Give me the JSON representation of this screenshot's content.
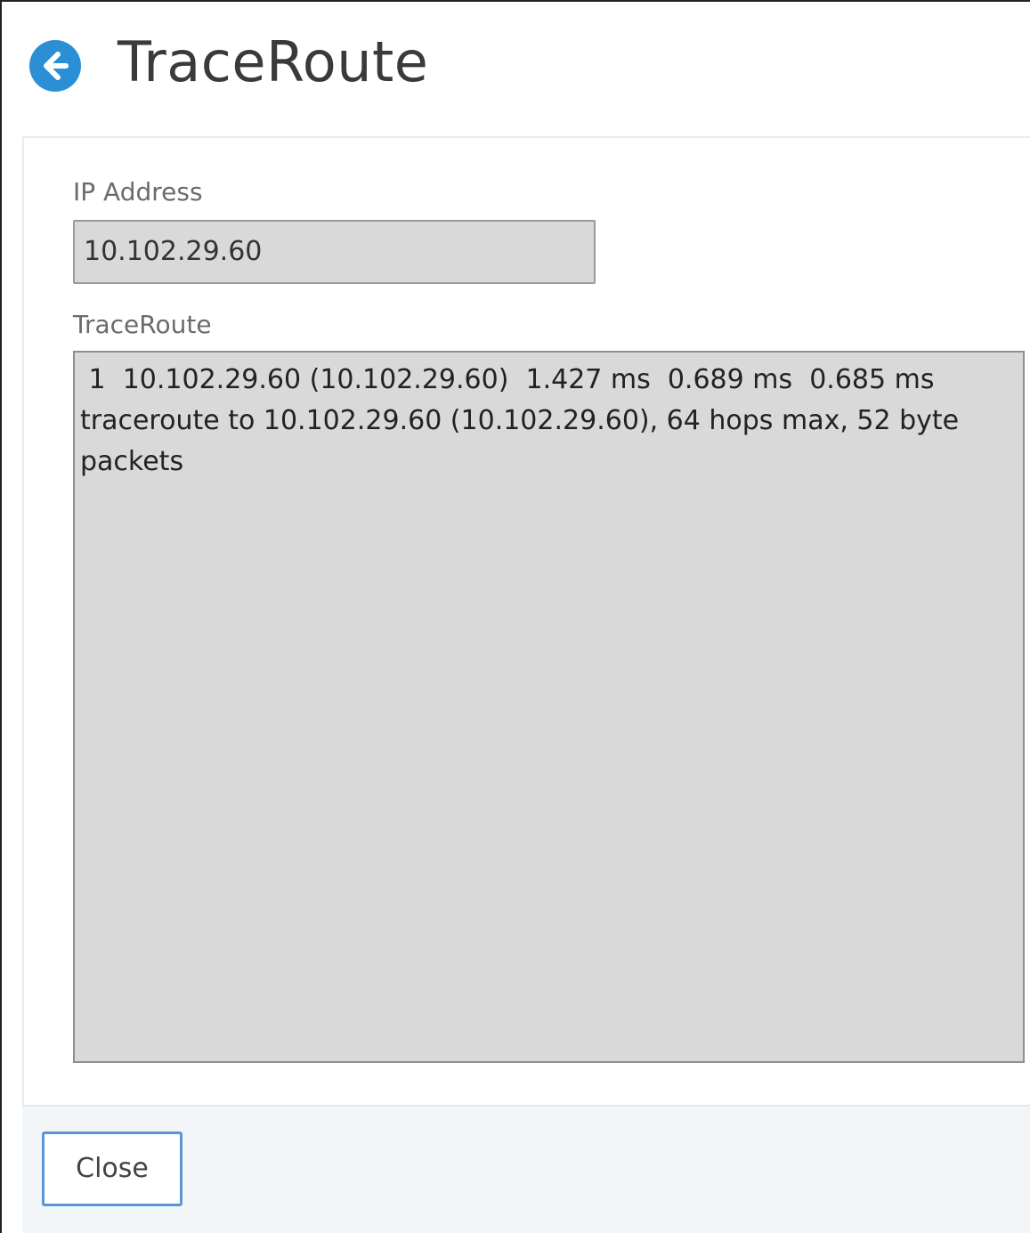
{
  "header": {
    "back_icon": "arrow-left-circle-icon",
    "title": "TraceRoute",
    "accent_color": "#2a8fd4"
  },
  "form": {
    "ip_label": "IP Address",
    "ip_value": "10.102.29.60",
    "traceroute_label": "TraceRoute",
    "traceroute_lines": [
      " 1  10.102.29.60 (10.102.29.60)  1.427 ms  0.689 ms  0.685 ms",
      "traceroute to 10.102.29.60 (10.102.29.60), 64 hops max, 52 byte packets"
    ]
  },
  "footer": {
    "close_label": "Close"
  }
}
